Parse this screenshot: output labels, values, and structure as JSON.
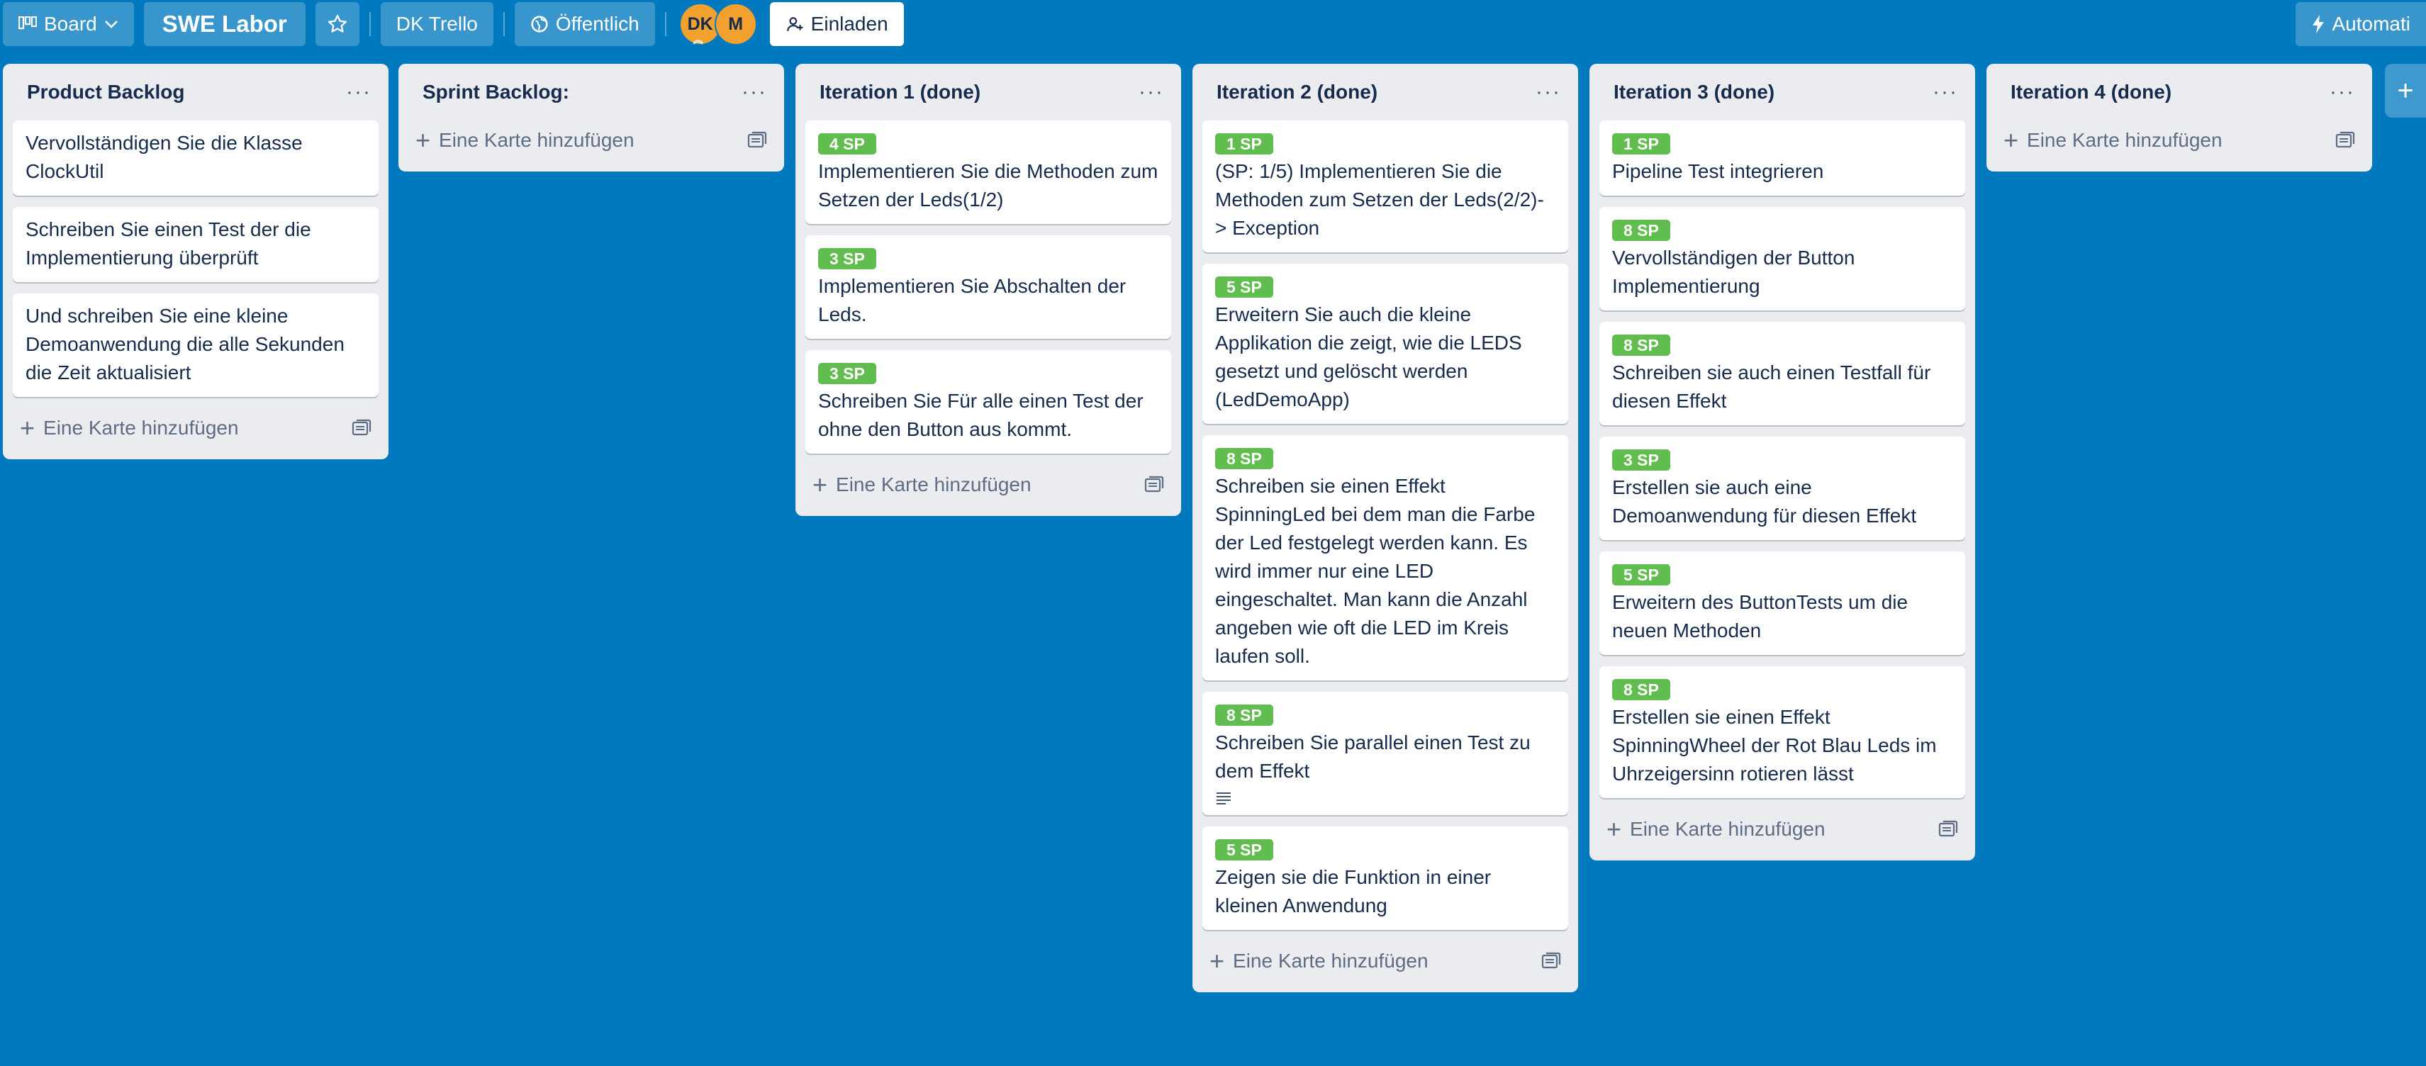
{
  "header": {
    "board_view_label": "Board",
    "board_title": "SWE Labor",
    "workspace": "DK Trello",
    "visibility": "Öffentlich",
    "members": [
      {
        "initials": "DK"
      },
      {
        "initials": "M"
      }
    ],
    "invite_label": "Einladen",
    "automation_label": "Automati"
  },
  "add_card_label": "Eine Karte hinzufügen",
  "lists": [
    {
      "title": "Product Backlog",
      "cards": [
        {
          "text": "Vervollständigen Sie die Klasse ClockUtil"
        },
        {
          "text": "Schreiben Sie einen Test der die Implementierung überprüft"
        },
        {
          "text": "Und schreiben Sie eine kleine Demoanwendung die alle Sekunden die Zeit aktualisiert"
        }
      ]
    },
    {
      "title": "Sprint Backlog:",
      "cards": []
    },
    {
      "title": "Iteration 1 (done)",
      "cards": [
        {
          "label": "4 SP",
          "text": "Implementieren Sie die Methoden zum Setzen der Leds(1/2)"
        },
        {
          "label": "3 SP",
          "text": "Implementieren Sie Abschalten der Leds."
        },
        {
          "label": "3 SP",
          "text": "Schreiben Sie Für alle einen Test der ohne den Button aus kommt."
        }
      ]
    },
    {
      "title": "Iteration 2 (done)",
      "cards": [
        {
          "label": "1 SP",
          "text": "(SP: 1/5) Implementieren Sie die Methoden zum Setzen der Leds(2/2)-> Exception"
        },
        {
          "label": "5 SP",
          "text": "Erweitern Sie auch die kleine Applikation die zeigt, wie die LEDS gesetzt und gelöscht werden (LedDemoApp)"
        },
        {
          "label": "8 SP",
          "text": "Schreiben sie einen Effekt SpinningLed bei dem man die Farbe der Led festgelegt werden kann. Es wird immer nur eine LED eingeschaltet. Man kann die Anzahl angeben wie oft die LED im Kreis laufen soll."
        },
        {
          "label": "8 SP",
          "text": "Schreiben Sie parallel einen Test zu dem Effekt",
          "has_description": true
        },
        {
          "label": "5 SP",
          "text": "Zeigen sie die Funktion in einer kleinen Anwendung"
        }
      ]
    },
    {
      "title": "Iteration 3 (done)",
      "cards": [
        {
          "label": "1 SP",
          "text": "Pipeline Test integrieren"
        },
        {
          "label": "8 SP",
          "text": "Vervollständigen der Button Implementierung"
        },
        {
          "label": "8 SP",
          "text": "Schreiben sie auch einen Testfall für diesen Effekt"
        },
        {
          "label": "3 SP",
          "text": "Erstellen sie auch eine Demoanwendung für diesen Effekt"
        },
        {
          "label": "5 SP",
          "text": "Erweitern des ButtonTests um die neuen Methoden"
        },
        {
          "label": "8 SP",
          "text": "Erstellen sie einen Effekt SpinningWheel der Rot Blau Leds im Uhrzeigersinn rotieren lässt"
        }
      ]
    },
    {
      "title": "Iteration 4 (done)",
      "cards": []
    }
  ],
  "colors": {
    "board_background": "#0079bf",
    "list_background": "#ebecf0",
    "label_green": "#61bd4f"
  },
  "icons": {
    "board_view": "board-columns-icon",
    "chevron": "chevron-down-icon",
    "star": "star-icon",
    "visibility": "globe-icon",
    "invite": "add-person-icon",
    "automation": "lightning-icon",
    "menu": "ellipsis-icon",
    "add": "plus-icon",
    "template": "card-template-icon",
    "description": "description-lines-icon"
  }
}
